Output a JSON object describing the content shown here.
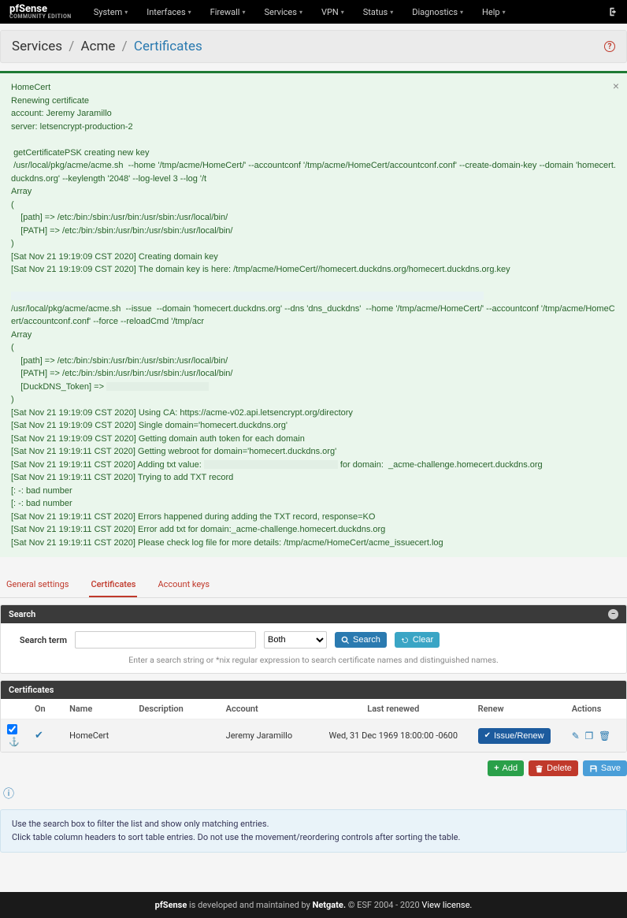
{
  "brand": {
    "name": "pfSense",
    "edition": "COMMUNITY EDITION"
  },
  "nav": [
    "System",
    "Interfaces",
    "Firewall",
    "Services",
    "VPN",
    "Status",
    "Diagnostics",
    "Help"
  ],
  "breadcrumb": {
    "l1": "Services",
    "l2": "Acme",
    "l3": "Certificates"
  },
  "alert": {
    "raw": "HomeCert\nRenewing certificate\naccount: Jeremy Jaramillo\nserver: letsencrypt-production-2\n\n getCertificatePSK creating new key\n /usr/local/pkg/acme/acme.sh  --home '/tmp/acme/HomeCert/' --accountconf '/tmp/acme/HomeCert/accountconf.conf' --create-domain-key --domain 'homecert.duckdns.org' --keylength '2048' --log-level 3 --log '/t\nArray\n(\n    [path] => /etc:/bin:/sbin:/usr/bin:/usr/sbin:/usr/local/bin/\n    [PATH] => /etc:/bin:/sbin:/usr/bin:/usr/sbin:/usr/local/bin/\n)\n[Sat Nov 21 19:19:09 CST 2020] Creating domain key\n[Sat Nov 21 19:19:09 CST 2020] The domain key is here: /tmp/acme/HomeCert//homecert.duckdns.org/homecert.duckdns.org.key\n\n",
    "r1": "/usr/local/pkg/acme/acme.sh  --issue  --domain 'homecert.duckdns.org' --dns 'dns_duckdns'  --home '/tmp/acme/HomeCert/' --accountconf '/tmp/acme/HomeCert/accountconf.conf' --force --reloadCmd '/tmp/acr",
    "r2": "Array\n(\n    [path] => /etc:/bin:/sbin:/usr/bin:/usr/sbin:/usr/local/bin/\n    [PATH] => /etc:/bin:/sbin:/usr/bin:/usr/sbin:/usr/local/bin/\n    [DuckDNS_Token] => ",
    "r3": "\n)\n[Sat Nov 21 19:19:09 CST 2020] Using CA: https://acme-v02.api.letsencrypt.org/directory\n[Sat Nov 21 19:19:09 CST 2020] Single domain='homecert.duckdns.org'\n[Sat Nov 21 19:19:09 CST 2020] Getting domain auth token for each domain\n[Sat Nov 21 19:19:11 CST 2020] Getting webroot for domain='homecert.duckdns.org'\n[Sat Nov 21 19:19:11 CST 2020] Adding txt value: ",
    "r4": " for domain:  _acme-challenge.homecert.duckdns.org\n[Sat Nov 21 19:19:11 CST 2020] Trying to add TXT record\n[: -: bad number\n[: -: bad number\n[Sat Nov 21 19:19:11 CST 2020] Errors happened during adding the TXT record, response=KO\n[Sat Nov 21 19:19:11 CST 2020] Error add txt for domain:_acme-challenge.homecert.duckdns.org\n[Sat Nov 21 19:19:11 CST 2020] Please check log file for more details: /tmp/acme/HomeCert/acme_issuecert.log"
  },
  "tabs": {
    "t1": "General settings",
    "t2": "Certificates",
    "t3": "Account keys"
  },
  "search": {
    "title": "Search",
    "label": "Search term",
    "placeholder": "",
    "select": "Both",
    "search_btn": "Search",
    "clear_btn": "Clear",
    "hint": "Enter a search string or *nix regular expression to search certificate names and distinguished names."
  },
  "table": {
    "title": "Certificates",
    "headers": {
      "on": "On",
      "name": "Name",
      "desc": "Description",
      "account": "Account",
      "last": "Last renewed",
      "renew": "Renew",
      "actions": "Actions"
    },
    "row": {
      "name": "HomeCert",
      "desc": "",
      "account": "Jeremy Jaramillo",
      "last": "Wed, 31 Dec 1969 18:00:00 -0600",
      "renew_btn": "Issue/Renew"
    }
  },
  "actions": {
    "add": "Add",
    "delete": "Delete",
    "save": "Save"
  },
  "info": {
    "l1": "Use the search box to filter the list and show only matching entries.",
    "l2": "Click table column headers to sort table entries. Do not use the movement/reordering controls after sorting the table."
  },
  "footer": {
    "p1": "pfSense",
    "p2": " is developed and maintained by ",
    "p3": "Netgate.",
    "p4": " © ESF 2004 - 2020 ",
    "p5": "View license."
  }
}
